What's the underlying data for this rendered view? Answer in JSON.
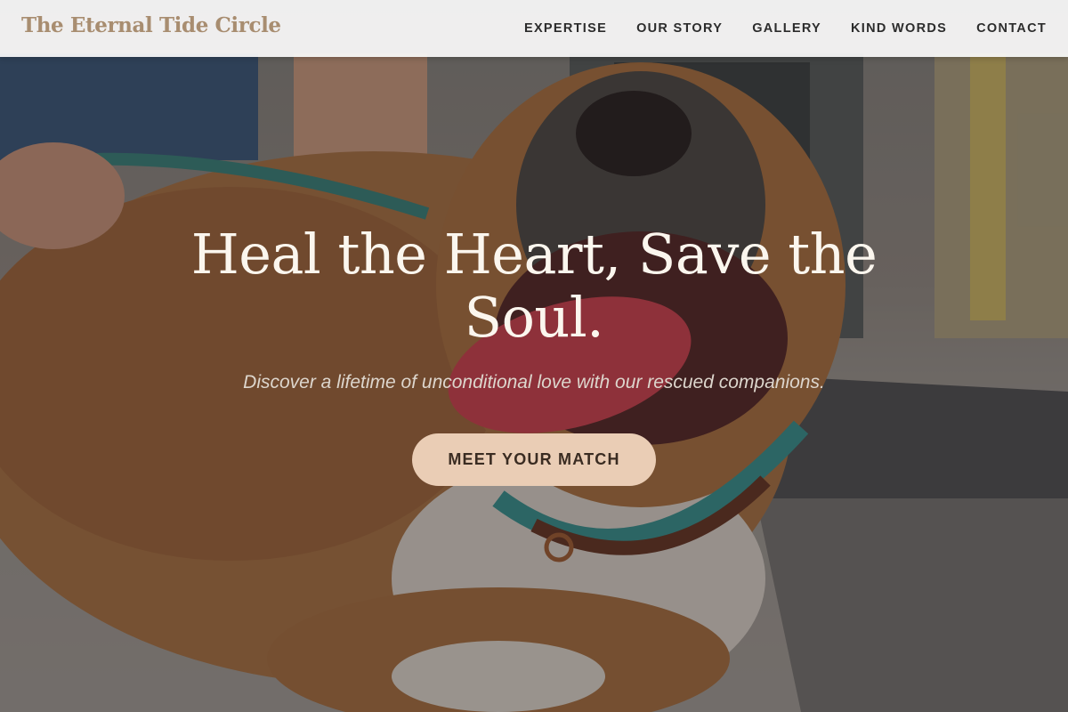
{
  "header": {
    "brand": "The Eternal Tide Circle",
    "nav": [
      {
        "label": "EXPERTISE"
      },
      {
        "label": "OUR STORY"
      },
      {
        "label": "GALLERY"
      },
      {
        "label": "KIND WORDS"
      },
      {
        "label": "CONTACT"
      }
    ]
  },
  "hero": {
    "title": "Heal the Heart, Save the Soul.",
    "subtitle": "Discover a lifetime of unconditional love with our rescued companions.",
    "cta_label": "MEET YOUR MATCH"
  },
  "colors": {
    "brand": "#a88d70",
    "nav_text": "#2c2c2c",
    "cta_background": "#eacdb5",
    "cta_text": "#3a2c22",
    "title_text": "#fbf6ee"
  }
}
